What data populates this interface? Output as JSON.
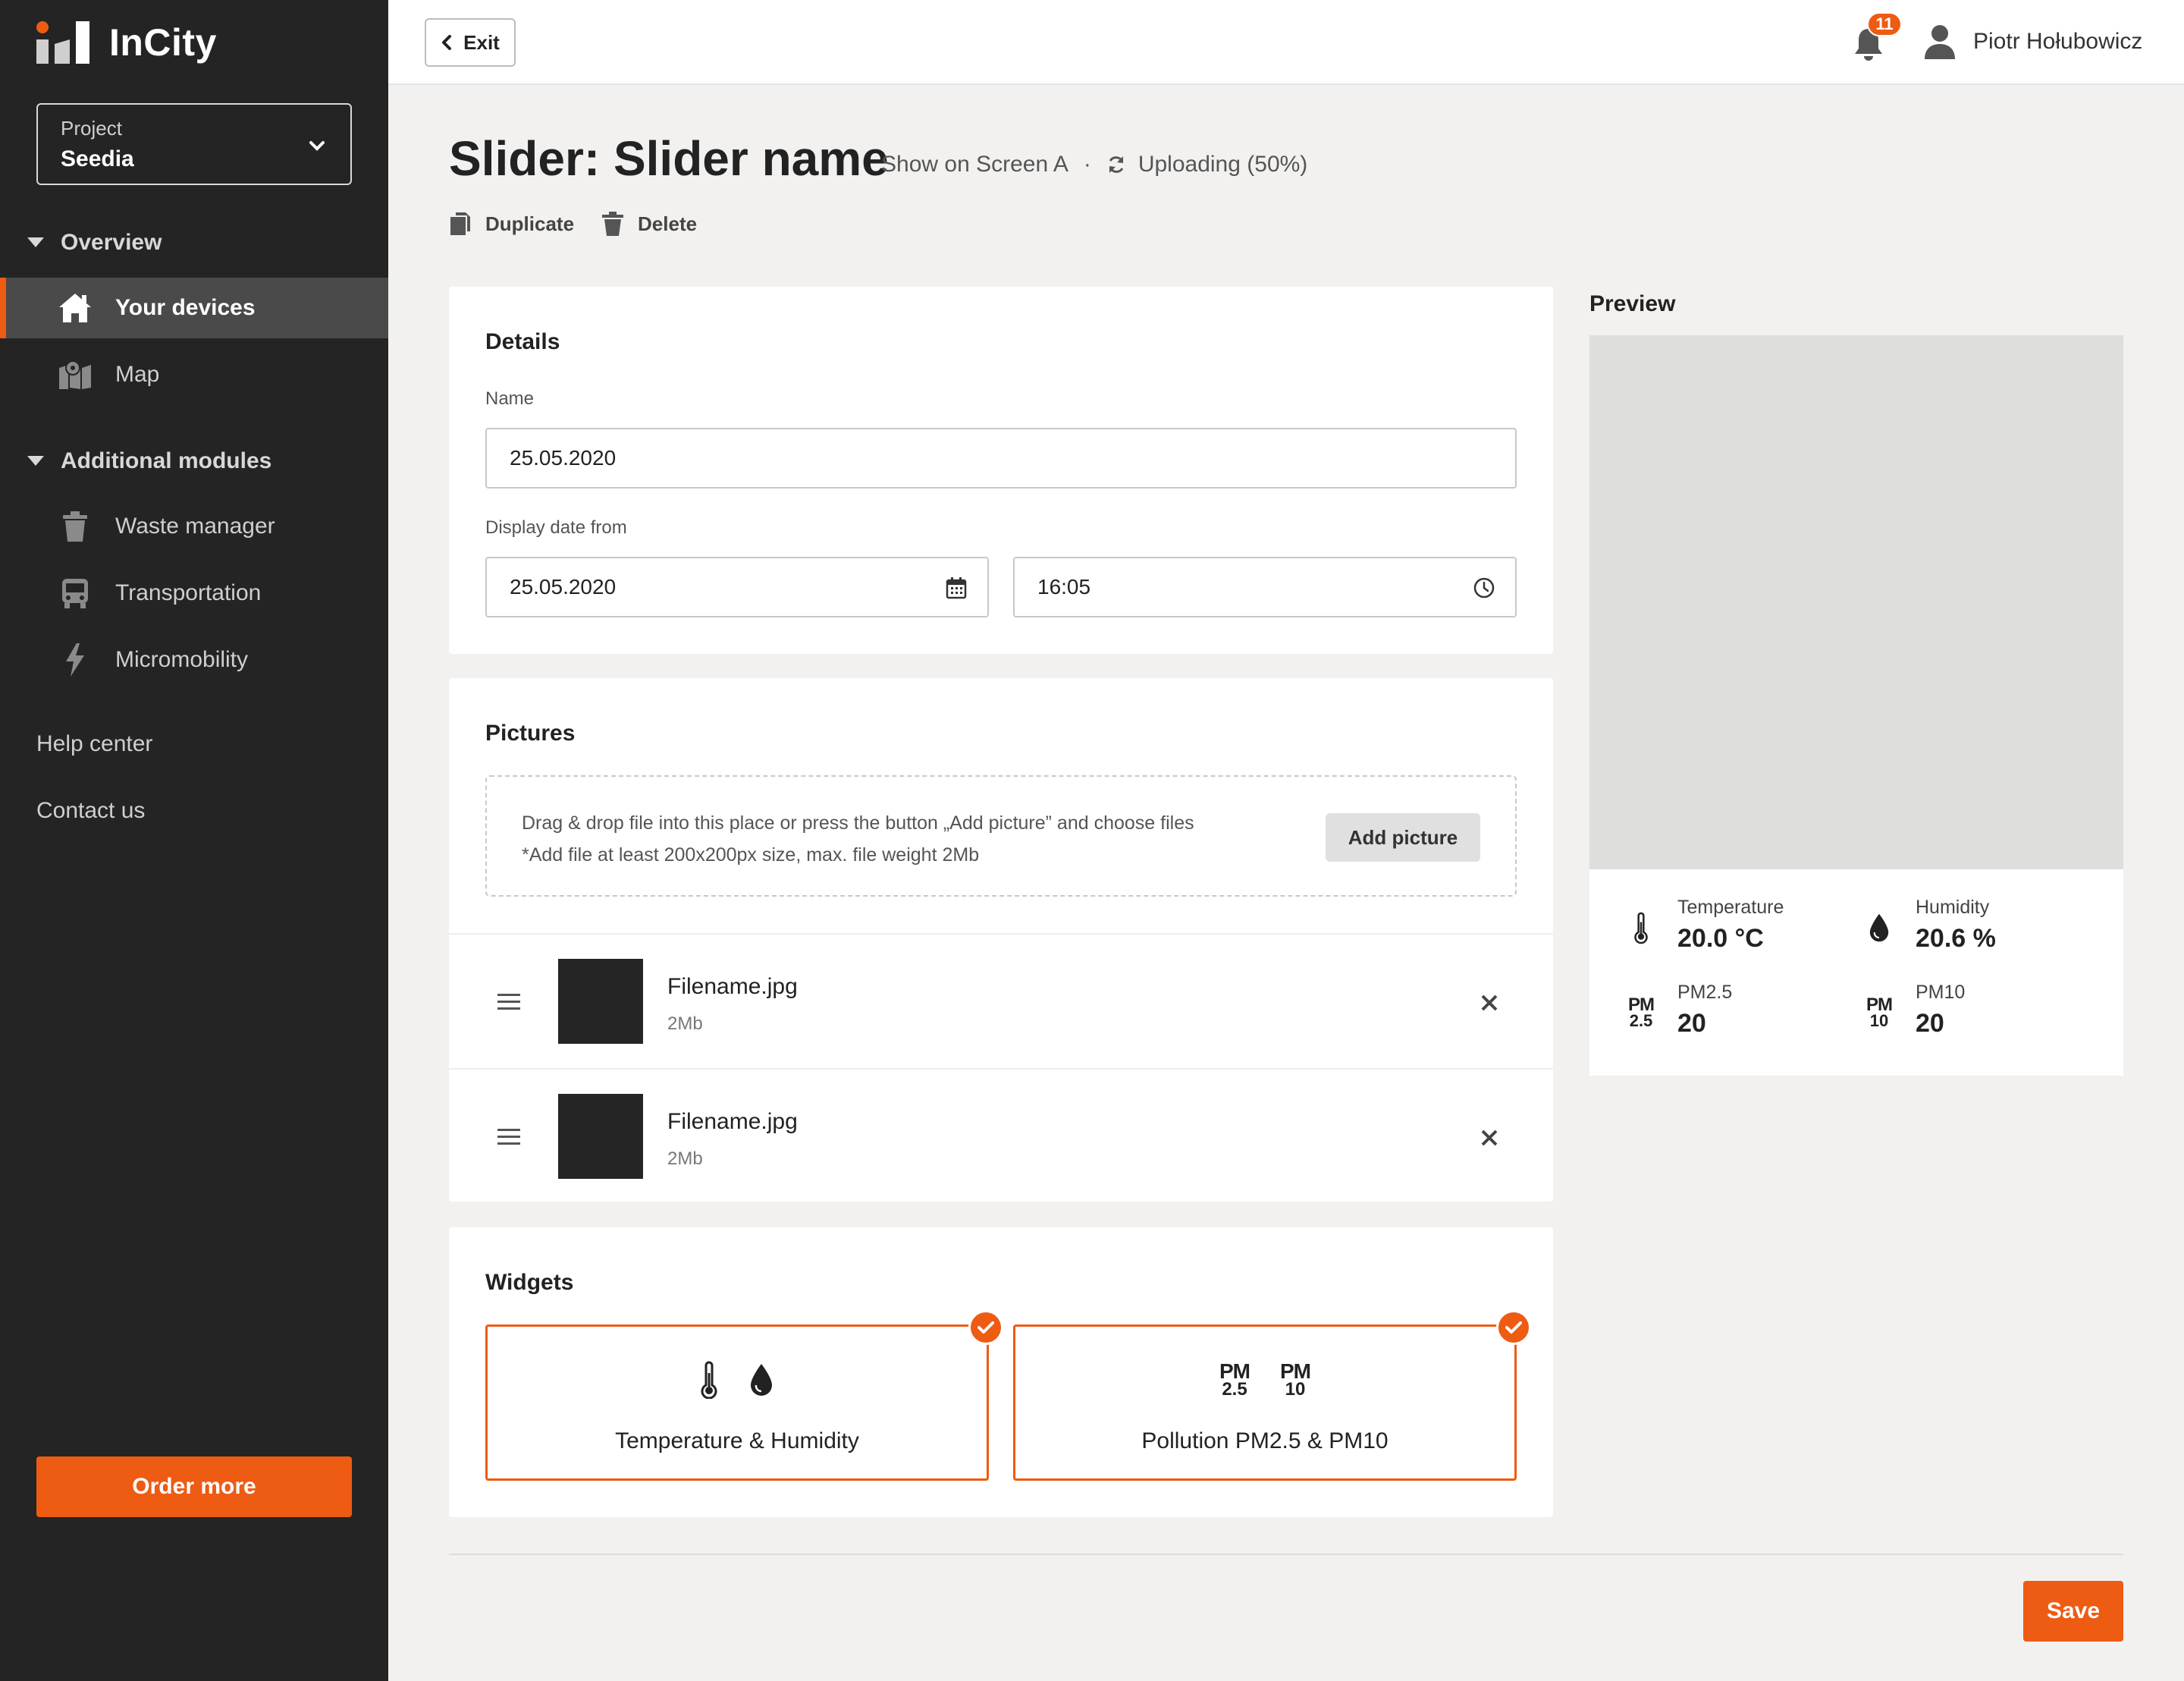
{
  "app": {
    "name": "InCity"
  },
  "project": {
    "label": "Project",
    "value": "Seedia"
  },
  "nav": {
    "overview": {
      "label": "Overview",
      "items": [
        {
          "label": "Your devices",
          "icon": "home-icon",
          "active": true
        },
        {
          "label": "Map",
          "icon": "map-icon",
          "active": false
        }
      ]
    },
    "modules": {
      "label": "Additional modules",
      "items": [
        {
          "label": "Waste manager",
          "icon": "trash-icon"
        },
        {
          "label": "Transportation",
          "icon": "bus-icon"
        },
        {
          "label": "Micromobility",
          "icon": "bolt-icon"
        }
      ]
    },
    "links": [
      "Help center",
      "Contact us"
    ]
  },
  "order_button": "Order more",
  "topbar": {
    "exit_label": "Exit",
    "notifications": "11",
    "user_name": "Piotr Hołubowicz"
  },
  "page": {
    "title": "Slider: Slider name",
    "screen": "Show on Screen A",
    "separator": "·",
    "status": "Uploading (50%)",
    "upload_progress": 0.5,
    "duplicate": "Duplicate",
    "delete": "Delete"
  },
  "details": {
    "title": "Details",
    "name_label": "Name",
    "name_value": "25.05.2020",
    "date_label": "Display date from",
    "date_value": "25.05.2020",
    "time_value": "16:05"
  },
  "pictures": {
    "title": "Pictures",
    "hint_line1": "Drag & drop file into this place or press the button „Add picture” and choose files",
    "hint_line2": "*Add file at least 200x200px size, max. file weight 2Mb",
    "add_button": "Add picture",
    "files": [
      {
        "name": "Filename.jpg",
        "size": "2Mb"
      },
      {
        "name": "Filename.jpg",
        "size": "2Mb"
      }
    ]
  },
  "widgets": {
    "title": "Widgets",
    "items": [
      {
        "label": "Temperature & Humidity",
        "selected": true
      },
      {
        "label": "Pollution PM2.5 & PM10",
        "selected": true
      }
    ]
  },
  "pm_icons": {
    "pm": "PM",
    "pm25": "2.5",
    "pm10": "10"
  },
  "preview": {
    "title": "Preview",
    "stats": [
      {
        "label": "Temperature",
        "value": "20.0 °C",
        "icon": "thermometer-icon"
      },
      {
        "label": "Humidity",
        "value": "20.6 %",
        "icon": "drop-icon"
      },
      {
        "label": "PM2.5",
        "value": "20",
        "icon": "pm25-icon"
      },
      {
        "label": "PM10",
        "value": "20",
        "icon": "pm10-icon"
      }
    ]
  },
  "save_button": "Save",
  "colors": {
    "accent": "#ee5b13",
    "sidebar": "#242424",
    "background": "#f2f1f0"
  }
}
